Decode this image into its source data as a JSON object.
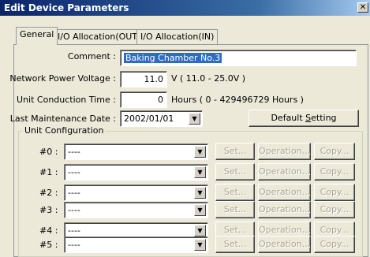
{
  "window": {
    "title": "Edit Device Parameters",
    "close_glyph": "✕"
  },
  "tabs": [
    "General",
    "I/O Allocation(OUT)",
    "I/O Allocation(IN)"
  ],
  "general": {
    "comment_label": "Comment :",
    "comment_value": "Baking Chamber No.3",
    "voltage_label": "Network Power Voltage :",
    "voltage_value": "11.0",
    "voltage_unit": "V ( 11.0 - 25.0V )",
    "conduction_label": "Unit Conduction Time :",
    "conduction_value": "0",
    "conduction_unit": "Hours ( 0 - 429496729 Hours )",
    "maintenance_label": "Last Maintenance Date :",
    "maintenance_value": "2002/01/01",
    "default_setting_prefix": "Default ",
    "default_setting_accel": "S",
    "default_setting_suffix": "etting"
  },
  "unit_configuration": {
    "title": "Unit Configuration",
    "buttons": {
      "set": "Set...",
      "operation": "Operation...",
      "copy": "Copy..."
    },
    "rows": [
      {
        "label": "#0 :",
        "value": "----"
      },
      {
        "label": "#1 :",
        "value": "----"
      },
      {
        "label": "#2 :",
        "value": "----"
      },
      {
        "label": "#3 :",
        "value": "----"
      },
      {
        "label": "#4 :",
        "value": "----"
      },
      {
        "label": "#5 :",
        "value": "----"
      }
    ]
  }
}
